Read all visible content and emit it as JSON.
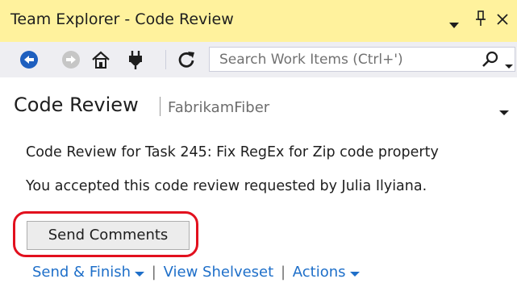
{
  "window": {
    "title": "Team Explorer - Code Review",
    "controls": [
      "dropdown-icon",
      "pin-icon",
      "close-icon"
    ]
  },
  "toolbar": {
    "icons": [
      "back-icon",
      "forward-icon",
      "home-icon",
      "connect-icon",
      "refresh-icon"
    ],
    "search": {
      "placeholder": "Search Work Items (Ctrl+')"
    }
  },
  "header": {
    "title": "Code Review",
    "project": "FabrikamFiber"
  },
  "review": {
    "task_line": "Code Review for Task 245: Fix RegEx for Zip code property",
    "status_line": "You accepted this code review requested by Julia Ilyiana."
  },
  "actions": {
    "send_comments": "Send Comments",
    "send_finish": "Send & Finish",
    "view_shelveset": "View Shelveset",
    "actions_menu": "Actions"
  },
  "colors": {
    "titlebar": "#fff29d",
    "toolbar": "#eeeef2",
    "link": "#1e6fc9",
    "highlight": "#e2101e",
    "back_icon": "#1e5fbf"
  }
}
